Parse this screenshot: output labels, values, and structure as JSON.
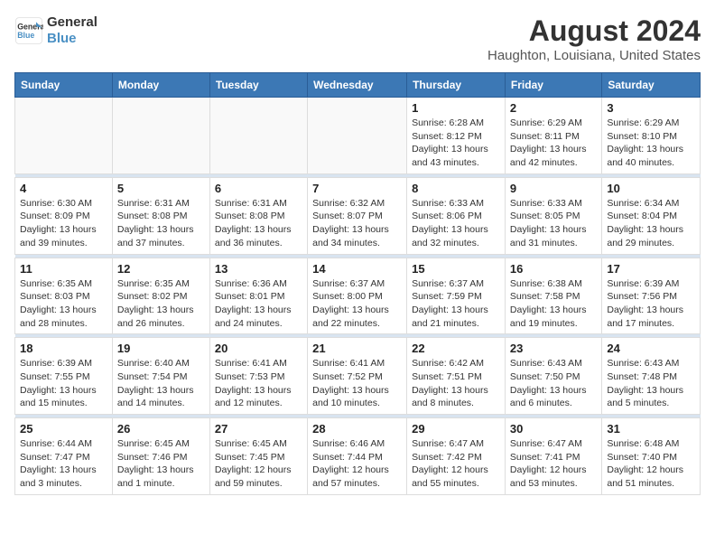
{
  "logo": {
    "line1": "General",
    "line2": "Blue"
  },
  "title": "August 2024",
  "subtitle": "Haughton, Louisiana, United States",
  "days_of_week": [
    "Sunday",
    "Monday",
    "Tuesday",
    "Wednesday",
    "Thursday",
    "Friday",
    "Saturday"
  ],
  "weeks": [
    [
      {
        "day": "",
        "info": ""
      },
      {
        "day": "",
        "info": ""
      },
      {
        "day": "",
        "info": ""
      },
      {
        "day": "",
        "info": ""
      },
      {
        "day": "1",
        "info": "Sunrise: 6:28 AM\nSunset: 8:12 PM\nDaylight: 13 hours\nand 43 minutes."
      },
      {
        "day": "2",
        "info": "Sunrise: 6:29 AM\nSunset: 8:11 PM\nDaylight: 13 hours\nand 42 minutes."
      },
      {
        "day": "3",
        "info": "Sunrise: 6:29 AM\nSunset: 8:10 PM\nDaylight: 13 hours\nand 40 minutes."
      }
    ],
    [
      {
        "day": "4",
        "info": "Sunrise: 6:30 AM\nSunset: 8:09 PM\nDaylight: 13 hours\nand 39 minutes."
      },
      {
        "day": "5",
        "info": "Sunrise: 6:31 AM\nSunset: 8:08 PM\nDaylight: 13 hours\nand 37 minutes."
      },
      {
        "day": "6",
        "info": "Sunrise: 6:31 AM\nSunset: 8:08 PM\nDaylight: 13 hours\nand 36 minutes."
      },
      {
        "day": "7",
        "info": "Sunrise: 6:32 AM\nSunset: 8:07 PM\nDaylight: 13 hours\nand 34 minutes."
      },
      {
        "day": "8",
        "info": "Sunrise: 6:33 AM\nSunset: 8:06 PM\nDaylight: 13 hours\nand 32 minutes."
      },
      {
        "day": "9",
        "info": "Sunrise: 6:33 AM\nSunset: 8:05 PM\nDaylight: 13 hours\nand 31 minutes."
      },
      {
        "day": "10",
        "info": "Sunrise: 6:34 AM\nSunset: 8:04 PM\nDaylight: 13 hours\nand 29 minutes."
      }
    ],
    [
      {
        "day": "11",
        "info": "Sunrise: 6:35 AM\nSunset: 8:03 PM\nDaylight: 13 hours\nand 28 minutes."
      },
      {
        "day": "12",
        "info": "Sunrise: 6:35 AM\nSunset: 8:02 PM\nDaylight: 13 hours\nand 26 minutes."
      },
      {
        "day": "13",
        "info": "Sunrise: 6:36 AM\nSunset: 8:01 PM\nDaylight: 13 hours\nand 24 minutes."
      },
      {
        "day": "14",
        "info": "Sunrise: 6:37 AM\nSunset: 8:00 PM\nDaylight: 13 hours\nand 22 minutes."
      },
      {
        "day": "15",
        "info": "Sunrise: 6:37 AM\nSunset: 7:59 PM\nDaylight: 13 hours\nand 21 minutes."
      },
      {
        "day": "16",
        "info": "Sunrise: 6:38 AM\nSunset: 7:58 PM\nDaylight: 13 hours\nand 19 minutes."
      },
      {
        "day": "17",
        "info": "Sunrise: 6:39 AM\nSunset: 7:56 PM\nDaylight: 13 hours\nand 17 minutes."
      }
    ],
    [
      {
        "day": "18",
        "info": "Sunrise: 6:39 AM\nSunset: 7:55 PM\nDaylight: 13 hours\nand 15 minutes."
      },
      {
        "day": "19",
        "info": "Sunrise: 6:40 AM\nSunset: 7:54 PM\nDaylight: 13 hours\nand 14 minutes."
      },
      {
        "day": "20",
        "info": "Sunrise: 6:41 AM\nSunset: 7:53 PM\nDaylight: 13 hours\nand 12 minutes."
      },
      {
        "day": "21",
        "info": "Sunrise: 6:41 AM\nSunset: 7:52 PM\nDaylight: 13 hours\nand 10 minutes."
      },
      {
        "day": "22",
        "info": "Sunrise: 6:42 AM\nSunset: 7:51 PM\nDaylight: 13 hours\nand 8 minutes."
      },
      {
        "day": "23",
        "info": "Sunrise: 6:43 AM\nSunset: 7:50 PM\nDaylight: 13 hours\nand 6 minutes."
      },
      {
        "day": "24",
        "info": "Sunrise: 6:43 AM\nSunset: 7:48 PM\nDaylight: 13 hours\nand 5 minutes."
      }
    ],
    [
      {
        "day": "25",
        "info": "Sunrise: 6:44 AM\nSunset: 7:47 PM\nDaylight: 13 hours\nand 3 minutes."
      },
      {
        "day": "26",
        "info": "Sunrise: 6:45 AM\nSunset: 7:46 PM\nDaylight: 13 hours\nand 1 minute."
      },
      {
        "day": "27",
        "info": "Sunrise: 6:45 AM\nSunset: 7:45 PM\nDaylight: 12 hours\nand 59 minutes."
      },
      {
        "day": "28",
        "info": "Sunrise: 6:46 AM\nSunset: 7:44 PM\nDaylight: 12 hours\nand 57 minutes."
      },
      {
        "day": "29",
        "info": "Sunrise: 6:47 AM\nSunset: 7:42 PM\nDaylight: 12 hours\nand 55 minutes."
      },
      {
        "day": "30",
        "info": "Sunrise: 6:47 AM\nSunset: 7:41 PM\nDaylight: 12 hours\nand 53 minutes."
      },
      {
        "day": "31",
        "info": "Sunrise: 6:48 AM\nSunset: 7:40 PM\nDaylight: 12 hours\nand 51 minutes."
      }
    ]
  ]
}
